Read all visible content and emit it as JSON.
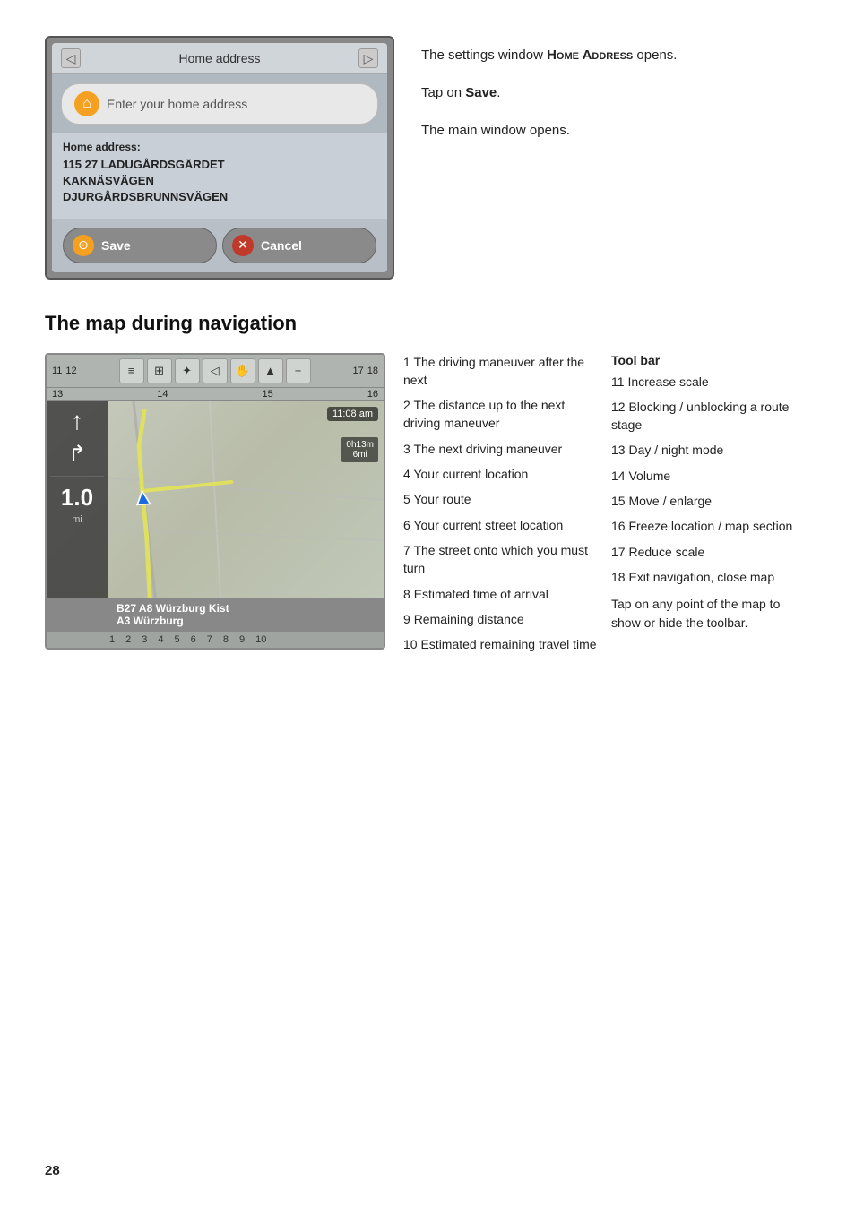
{
  "page_number": "28",
  "top_section": {
    "device": {
      "nav_back_label": "◁",
      "nav_title": "Home address",
      "nav_forward_label": "▷",
      "input_placeholder": "Enter your home address",
      "address_label": "Home address:",
      "address_line1": "115 27 LADUGÅRDSGÄRDET",
      "address_line2": "KAKNÄSVÄGEN",
      "address_line3": "DJURGÅRDSBRUNNSVÄGEN",
      "save_btn": "Save",
      "cancel_btn": "Cancel"
    },
    "text1": "The settings window ",
    "text1_brand": "Home Address",
    "text1_end": " opens.",
    "text2_prefix": "Tap on ",
    "text2_bold": "Save",
    "text2_end": ".",
    "text3": "The main window opens."
  },
  "section_heading": "The map during navigation",
  "map": {
    "toolbar_numbers": [
      "11",
      "12",
      "13",
      "14",
      "15",
      "16",
      "17",
      "18"
    ],
    "toolbar_icons": [
      "≡",
      "⊞",
      "✦",
      "◁",
      "✋",
      "▲",
      "✚"
    ],
    "maneuver_arrow": "↑",
    "maneuver_arrow2": "↱",
    "distance_value": "1.0",
    "distance_unit": "mi",
    "time": "11:08 am",
    "eta_top": "0h13m",
    "eta_bottom": "6mi",
    "street1": "B27 A8 Würzburg Kist",
    "street2": "A3 Würzburg",
    "numbers_bottom": [
      "1",
      "2",
      "3",
      "4",
      "5",
      "6",
      "7",
      "8",
      "9",
      "10"
    ]
  },
  "descriptions": {
    "col1": [
      {
        "num": "1",
        "text": "The driving maneuver after the next"
      },
      {
        "num": "2",
        "text": "The distance up to the next driving maneuver"
      },
      {
        "num": "3",
        "text": "The next driving maneuver"
      },
      {
        "num": "4",
        "text": "Your current location"
      },
      {
        "num": "5",
        "text": "Your route"
      },
      {
        "num": "6",
        "text": "Your current street location"
      },
      {
        "num": "7",
        "text": "The street onto which you must turn"
      },
      {
        "num": "8",
        "text": "Estimated time of arrival"
      },
      {
        "num": "9",
        "text": "Remaining distance"
      },
      {
        "num": "10",
        "text": "Estimated remaining travel time"
      }
    ],
    "col2_title": "Tool bar",
    "col2": [
      {
        "num": "11",
        "text": "Increase scale"
      },
      {
        "num": "12",
        "text": "Blocking / unblocking a route stage"
      },
      {
        "num": "13",
        "text": "Day / night mode"
      },
      {
        "num": "14",
        "text": "Volume"
      },
      {
        "num": "15",
        "text": "Move / enlarge"
      },
      {
        "num": "16",
        "text": "Freeze location / map section"
      },
      {
        "num": "17",
        "text": "Reduce scale"
      },
      {
        "num": "18",
        "text": "Exit navigation, close map"
      }
    ],
    "tap_note": "Tap on any point of the map to show or hide the toolbar."
  }
}
